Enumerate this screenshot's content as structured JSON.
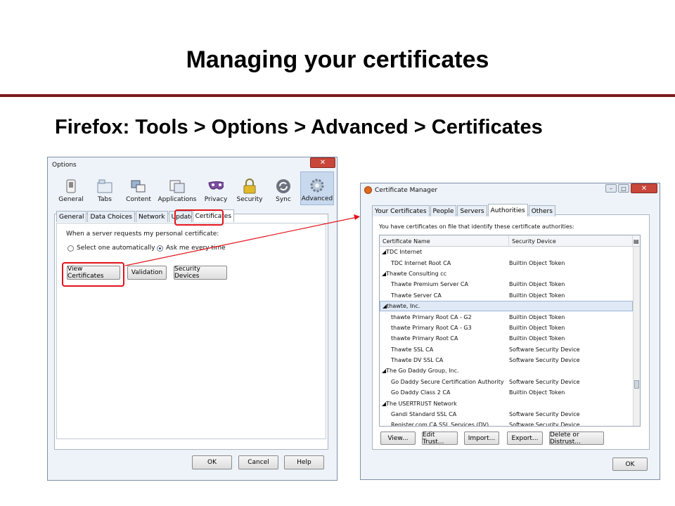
{
  "slide": {
    "title": "Managing your certificates",
    "subtitle": "Firefox: Tools > Options > Advanced > Certificates"
  },
  "colors": {
    "title_rule": "#7a1a1a",
    "highlight": "#e0141b",
    "selected_row": "#dfe9f6"
  },
  "options": {
    "title": "Options",
    "close": "✕",
    "toolbar": [
      {
        "label": "General",
        "icon": "switch-icon"
      },
      {
        "label": "Tabs",
        "icon": "tabs-icon"
      },
      {
        "label": "Content",
        "icon": "content-icon"
      },
      {
        "label": "Applications",
        "icon": "applications-icon"
      },
      {
        "label": "Privacy",
        "icon": "mask-icon"
      },
      {
        "label": "Security",
        "icon": "lock-icon"
      },
      {
        "label": "Sync",
        "icon": "sync-icon"
      },
      {
        "label": "Advanced",
        "icon": "gear-icon"
      }
    ],
    "subtabs": [
      "General",
      "Data Choices",
      "Network",
      "Update",
      "Certificates"
    ],
    "request_label": "When a server requests my personal certificate:",
    "radio_auto": "Select one automatically",
    "radio_ask": "Ask me every time",
    "btn_view": "View Certificates",
    "btn_validation": "Validation",
    "btn_devices": "Security Devices",
    "btn_ok": "OK",
    "btn_cancel": "Cancel",
    "btn_help": "Help"
  },
  "cert_manager": {
    "title": "Certificate Manager",
    "tabs": [
      "Your Certificates",
      "People",
      "Servers",
      "Authorities",
      "Others"
    ],
    "active_tab": "Authorities",
    "description": "You have certificates on file that identify these certificate authorities:",
    "columns": [
      "Certificate Name",
      "Security Device"
    ],
    "rows": [
      {
        "name": "◢TDC Internet",
        "device": ""
      },
      {
        "name": "TDC Internet Root CA",
        "device": "Builtin Object Token"
      },
      {
        "name": "◢Thawte Consulting cc",
        "device": ""
      },
      {
        "name": "Thawte Premium Server CA",
        "device": "Builtin Object Token"
      },
      {
        "name": "Thawte Server CA",
        "device": "Builtin Object Token"
      },
      {
        "name": "◢thawte, Inc.",
        "device": ""
      },
      {
        "name": "thawte Primary Root CA - G2",
        "device": "Builtin Object Token"
      },
      {
        "name": "thawte Primary Root CA - G3",
        "device": "Builtin Object Token"
      },
      {
        "name": "thawte Primary Root CA",
        "device": "Builtin Object Token"
      },
      {
        "name": "Thawte SSL CA",
        "device": "Software Security Device"
      },
      {
        "name": "Thawte DV SSL CA",
        "device": "Software Security Device"
      },
      {
        "name": "◢The Go Daddy Group, Inc.",
        "device": ""
      },
      {
        "name": "Go Daddy Secure Certification Authority",
        "device": "Software Security Device"
      },
      {
        "name": "Go Daddy Class 2 CA",
        "device": "Builtin Object Token"
      },
      {
        "name": "◢The USERTRUST Network",
        "device": ""
      },
      {
        "name": "Gandi Standard SSL CA",
        "device": "Software Security Device"
      },
      {
        "name": "Register.com CA SSL Services (DV)",
        "device": "Software Security Device"
      }
    ],
    "selected_row": 5,
    "buttons": [
      "View...",
      "Edit Trust...",
      "Import...",
      "Export...",
      "Delete or Distrust..."
    ],
    "btn_ok": "OK"
  }
}
